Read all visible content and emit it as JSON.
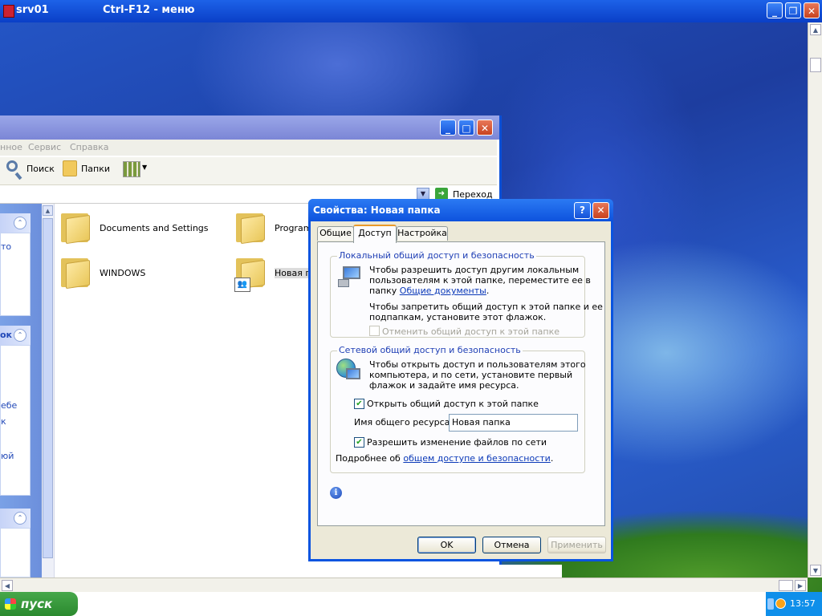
{
  "session": {
    "host": "srv01",
    "menu_hint": "Ctrl-F12 - меню",
    "min_icon": "minimize-icon",
    "max_icon": "restore-icon",
    "close_icon": "close-icon"
  },
  "explorer": {
    "menu": [
      "нное",
      "Сервис",
      "Справка"
    ],
    "toolbar": {
      "search_label": "Поиск",
      "folders_label": "Папки"
    },
    "address": {
      "go_label": "Переход"
    },
    "tasks": {
      "links1": [
        "то"
      ],
      "header2": "ок",
      "links2": [
        "ебе",
        "к",
        "юй"
      ]
    },
    "files": [
      {
        "name": "Documents and Settings",
        "shared": false
      },
      {
        "name": "Program",
        "shared": false
      },
      {
        "name": "WINDOWS",
        "shared": false
      },
      {
        "name": "Новая п",
        "shared": true
      }
    ]
  },
  "dialog": {
    "title": "Свойства: Новая папка",
    "tabs": [
      "Общие",
      "Доступ",
      "Настройка"
    ],
    "active_tab": "Доступ",
    "local_group": {
      "title": "Локальный общий доступ и безопасность",
      "line1": "Чтобы разрешить доступ другим локальным",
      "line2": "пользователям к этой папке, переместите ее в",
      "line3_prefix": "папку ",
      "line3_link": "Общие документы",
      "line3_suffix": ".",
      "line4": "Чтобы запретить общий доступ к этой папке и ее",
      "line5": "подпапкам, установите этот флажок.",
      "checkbox_label": "Отменить общий доступ к этой папке",
      "checkbox_checked": false,
      "checkbox_enabled": false
    },
    "network_group": {
      "title": "Сетевой общий доступ и безопасность",
      "line1": "Чтобы открыть доступ и пользователям этого",
      "line2": "компьютера, и по сети, установите первый",
      "line3": "флажок и задайте имя ресурса.",
      "share_checkbox_label": "Открыть общий доступ к этой папке",
      "share_checked": true,
      "share_name_label": "Имя общего ресурса:",
      "share_name_value": "Новая папка",
      "allow_change_label": "Разрешить изменение файлов по сети",
      "allow_change_checked": true,
      "more_prefix": "Подробнее об ",
      "more_link": "общем доступе и безопасности",
      "more_suffix": "."
    },
    "buttons": {
      "ok": "OK",
      "cancel": "Отмена",
      "apply": "Применить"
    }
  },
  "taskbar": {
    "start_label": "пуск",
    "clock": "13:57"
  }
}
